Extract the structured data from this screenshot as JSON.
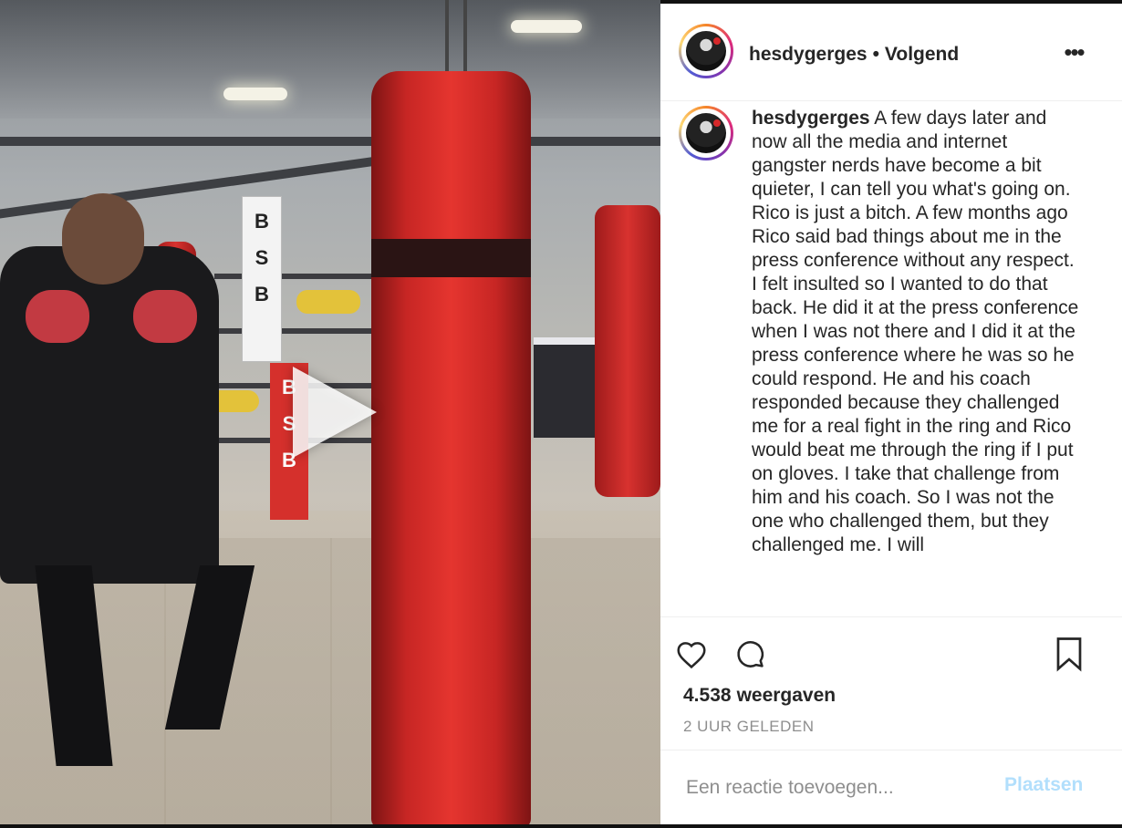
{
  "post": {
    "username": "hesdygerges",
    "separator": "•",
    "follow_status": "Volgend",
    "more_label": "•••",
    "caption_user": "hesdygerges",
    "caption_text": "A few days later and now all the media and internet gangster nerds have become a bit quieter, I can tell you what's going on. Rico is just a bitch. A few months ago Rico said bad things about me in the press conference without any respect. I felt insulted so I wanted to do that back. He did it at the press conference when I was not there and I did it at the press conference where he was so he could respond. He and his coach responded because they challenged me for a real fight in the ring and Rico would beat me through the ring if I put on gloves. I take that challenge from him and his coach. So I was not the one who challenged them, but they challenged me. I will",
    "views_count": "4.538",
    "views_label": "weergaven",
    "timestamp": "2 UUR GELEDEN"
  },
  "comment_box": {
    "placeholder": "Een reactie toevoegen...",
    "post_label": "Plaatsen"
  },
  "icons": {
    "like": "heart-icon",
    "comment": "comment-bubble-icon",
    "save": "bookmark-icon",
    "play": "play-icon",
    "more": "more-options-icon"
  },
  "colors": {
    "text": "#262626",
    "muted": "#8e8e8e",
    "post_disabled": "#b2dffc",
    "border": "#efefef"
  }
}
